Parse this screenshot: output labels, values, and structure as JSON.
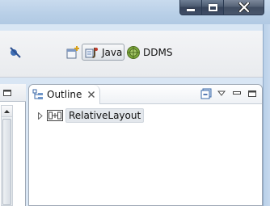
{
  "window": {
    "caption_buttons": [
      {
        "name": "minimize",
        "icon": "minimize-icon"
      },
      {
        "name": "maximize",
        "icon": "maximize-icon"
      },
      {
        "name": "close",
        "icon": "close-icon"
      }
    ]
  },
  "toolbar": {
    "icons": [
      "skip-breakpoints-icon",
      "open-perspective-icon",
      "java-perspective-icon",
      "ddms-perspective-icon"
    ],
    "perspectives": [
      {
        "label": "Java",
        "active": true
      },
      {
        "label": "DDMS",
        "active": false
      }
    ]
  },
  "outline": {
    "tab_label": "Outline",
    "tab_icon": "outline-icon",
    "view_tools": [
      "collapse-all-icon",
      "view-menu-icon",
      "minimize-icon",
      "maximize-icon"
    ],
    "tree": [
      {
        "label": "RelativeLayout",
        "icon": "relative-layout-icon",
        "expanded": false
      }
    ]
  },
  "colors": {
    "frame": "#b8cfe7",
    "toolbar": "#eceef1",
    "selection": "#e3e7ec",
    "close_glyph": "#ffffff"
  }
}
